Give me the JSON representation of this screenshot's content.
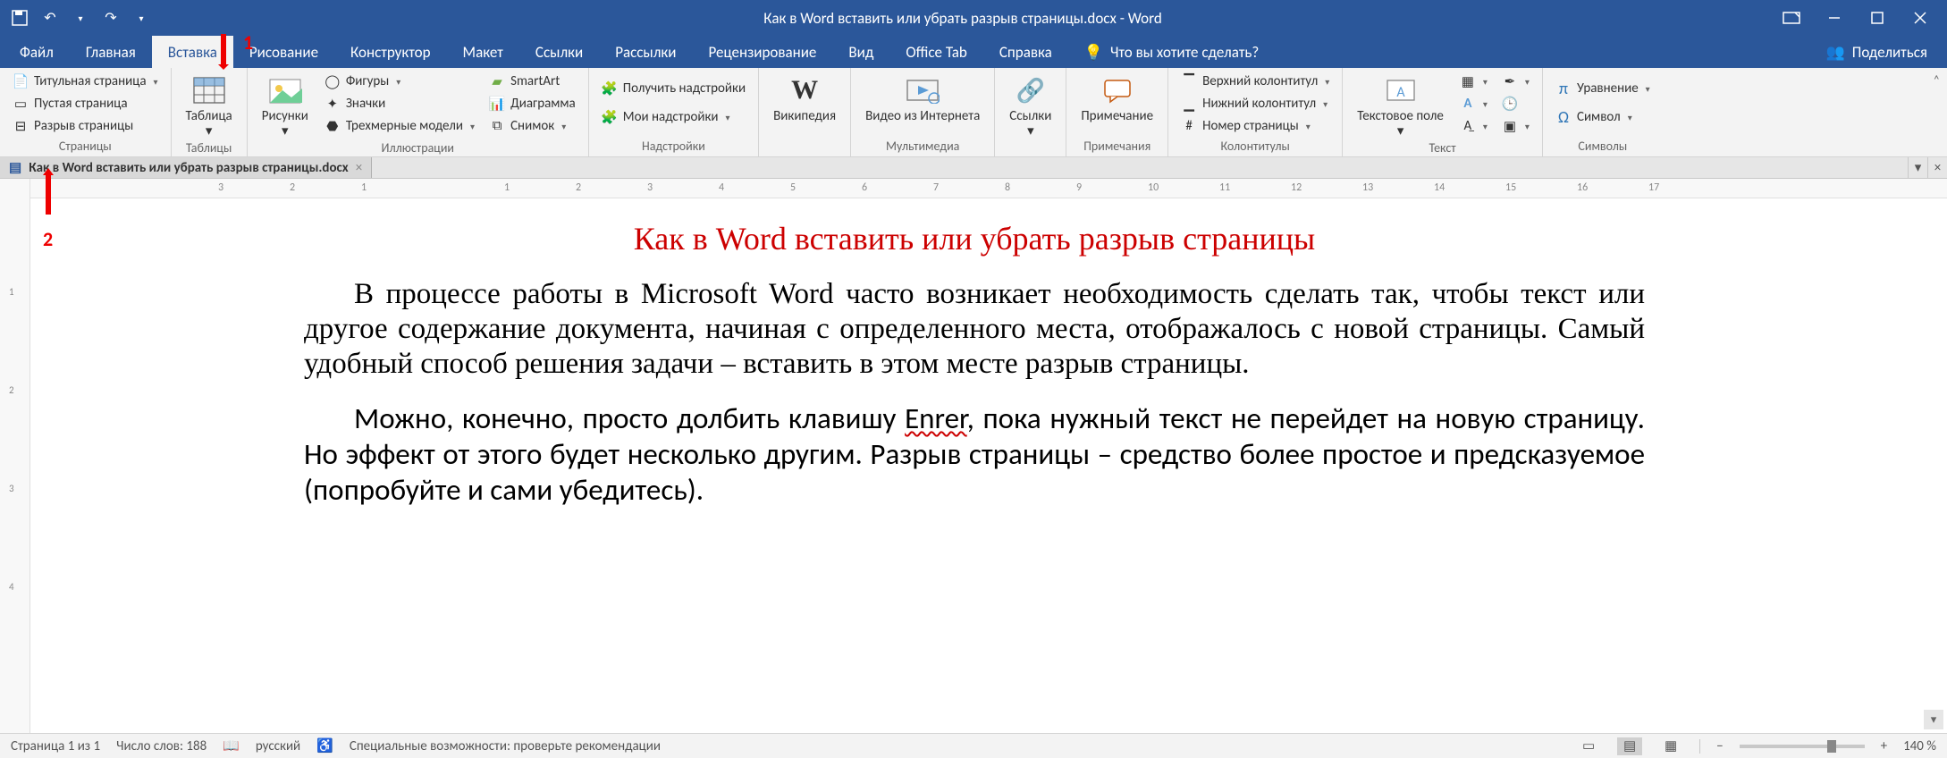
{
  "title": "Как в Word вставить или убрать разрыв страницы.docx  -  Word",
  "tabs": {
    "file": "Файл",
    "home": "Главная",
    "insert": "Вставка",
    "draw": "Рисование",
    "design": "Конструктор",
    "layout": "Макет",
    "references": "Ссылки",
    "mailings": "Рассылки",
    "review": "Рецензирование",
    "view": "Вид",
    "officetab": "Office Tab",
    "help": "Справка"
  },
  "tellme": "Что вы хотите сделать?",
  "share": "Поделиться",
  "ribbon": {
    "pages": {
      "label": "Страницы",
      "cover": "Титульная страница",
      "blank": "Пустая страница",
      "break": "Разрыв страницы"
    },
    "tables": {
      "label": "Таблицы",
      "table": "Таблица"
    },
    "illus": {
      "label": "Иллюстрации",
      "pictures": "Рисунки",
      "shapes": "Фигуры",
      "icons": "Значки",
      "models": "Трехмерные модели",
      "smartart": "SmartArt",
      "chart": "Диаграмма",
      "screenshot": "Снимок"
    },
    "addins": {
      "label": "Надстройки",
      "get": "Получить надстройки",
      "my": "Мои надстройки"
    },
    "wiki": "Википедия",
    "media": {
      "label": "Мультимедиа",
      "video": "Видео из Интернета"
    },
    "links": {
      "label": "Ссылки",
      "links_btn": "Ссылки"
    },
    "comments": {
      "label": "Примечания",
      "comment": "Примечание"
    },
    "headerfooter": {
      "label": "Колонтитулы",
      "header": "Верхний колонтитул",
      "footer": "Нижний колонтитул",
      "pagenum": "Номер страницы"
    },
    "text": {
      "label": "Текст",
      "textbox": "Текстовое поле"
    },
    "symbols": {
      "label": "Символы",
      "equation": "Уравнение",
      "symbol": "Символ"
    }
  },
  "doctab": "Как в Word вставить или убрать разрыв страницы.docx",
  "ruler_numbers": [
    "3",
    "2",
    "1",
    "1",
    "2",
    "3",
    "4",
    "5",
    "6",
    "7",
    "8",
    "9",
    "10",
    "11",
    "12",
    "13",
    "14",
    "15",
    "16",
    "17"
  ],
  "vruler_numbers": [
    "1",
    "2",
    "3",
    "4"
  ],
  "annotations": {
    "one": "1",
    "two": "2"
  },
  "document": {
    "title": "Как в Word вставить или убрать разрыв страницы",
    "p1a": "В процессе работы в Microsoft Word часто возникает необходимость сделать так, чтобы текст или другое содержание документа, начиная с определенного места, отображалось с новой страницы. Самый удобный способ решения задачи – вставить в этом месте разрыв страницы.",
    "p2a": "Можно, конечно, просто долбить клавишу ",
    "p2_err": "Enrer",
    "p2b": ", пока нужный текст не перейдет на новую страницу. Но эффект от этого будет несколько другим. Разрыв страницы – средство более простое и предсказуемое (попробуйте и сами убедитесь)."
  },
  "status": {
    "page": "Страница 1 из 1",
    "words": "Число слов: 188",
    "lang": "русский",
    "a11y": "Специальные возможности: проверьте рекомендации",
    "zoom": "140 %"
  }
}
